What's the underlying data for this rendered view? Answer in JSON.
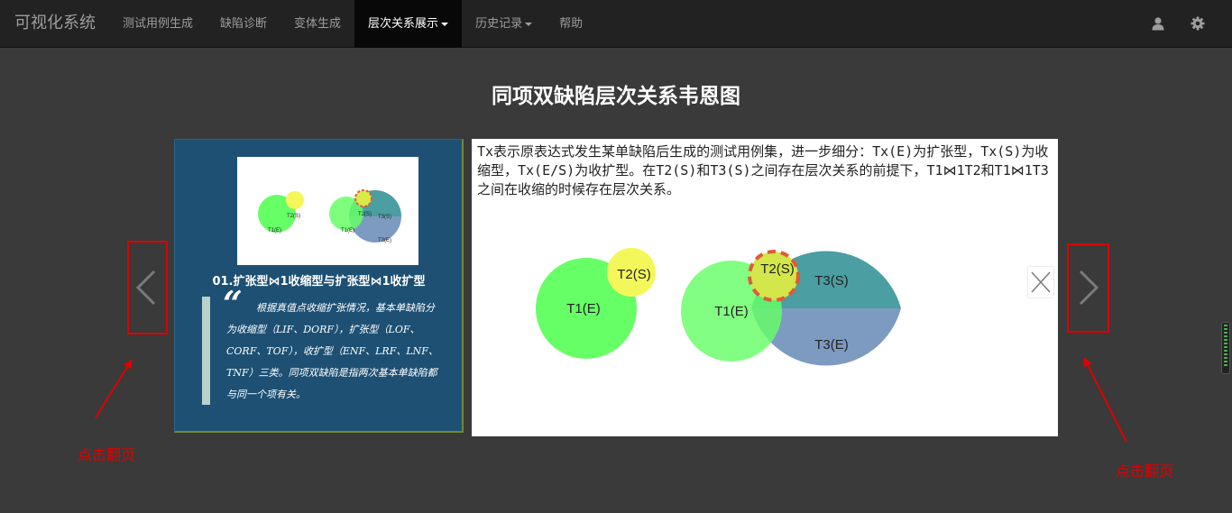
{
  "navbar": {
    "brand": "可视化系统",
    "items": [
      {
        "label": "测试用例生成"
      },
      {
        "label": "缺陷诊断"
      },
      {
        "label": "变体生成"
      },
      {
        "label": "层次关系展示"
      },
      {
        "label": "历史记录"
      },
      {
        "label": "帮助"
      }
    ],
    "icons": {
      "user": "user-icon",
      "settings": "gear-icon"
    }
  },
  "page_title": "同项双缺陷层次关系韦恩图",
  "left_slide": {
    "thumbnail_labels": {
      "t1e_a": "T1(E)",
      "t2s_a": "T2(S)",
      "t1e_b": "T1(E)",
      "t2s_b": "T2(S)",
      "t3s": "T3(S)",
      "t3e": "T3(E)"
    },
    "heading": "01.扩张型⋈1收缩型与扩张型⋈1收扩型",
    "quote_mark": "“",
    "quote": "根据真值点收缩扩张情况，基本单缺陷分为收缩型（LIF、DORF），扩张型（LOF、CORF、TOF），收扩型（ENF、LRF、LNF、TNF）三类。同项双缺陷是指两次基本单缺陷都与同一个项有关。"
  },
  "right_slide": {
    "description": "Tx表示原表达式发生某单缺陷后生成的测试用例集，进一步细分：Tx(E)为扩张型，Tx(S)为收缩型，Tx(E/S)为收扩型。在T2(S)和T3(S)之间存在层次关系的前提下，T1⋈1T2和T1⋈1T3之间在收缩的时候存在层次关系。",
    "venn_labels": {
      "t1e_a": "T1(E)",
      "t2s_a": "T2(S)",
      "t1e_b": "T1(E)",
      "t2s_b": "T2(S)",
      "t3s": "T3(S)",
      "t3e": "T3(E)"
    },
    "close_icon": "close-icon"
  },
  "annotations": {
    "left": "点击翻页",
    "right": "点击翻页"
  },
  "colors": {
    "navbar": "#222222",
    "background": "#3a3a3a",
    "slide_blue": "#1d5073",
    "green": "#66ff66",
    "yellow": "#f4f75a",
    "teal": "#4b9ea1",
    "slate": "#7d9bc1",
    "annotation_red": "#e00000"
  }
}
